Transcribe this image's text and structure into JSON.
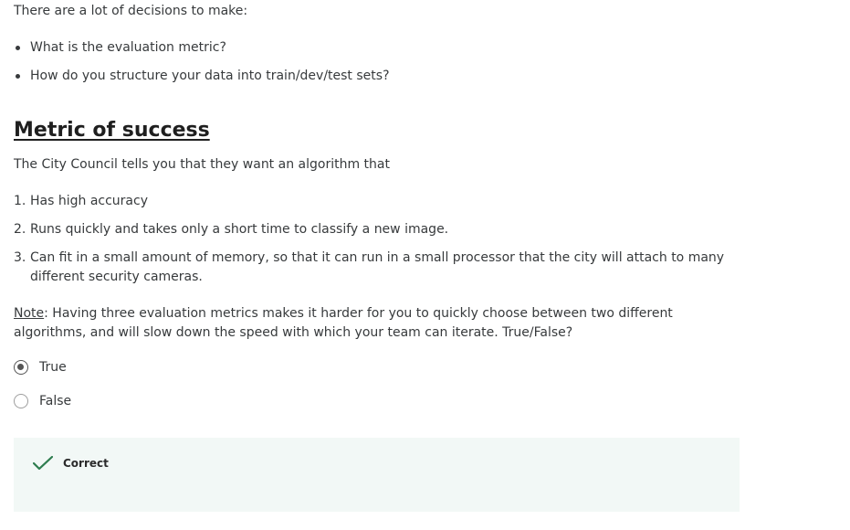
{
  "intro_text": "There are a lot of decisions to make:",
  "bullets": [
    "What is the evaluation metric?",
    "How do you structure your data into train/dev/test sets?"
  ],
  "section_title": "Metric of success",
  "council_text": "The City Council tells you that they want an algorithm that",
  "requirements": [
    {
      "num": "1.",
      "text": "Has high accuracy"
    },
    {
      "num": "2.",
      "text": "Runs quickly and takes only a short time to classify a new image."
    },
    {
      "num": "3.",
      "text": "Can fit in a small amount of memory, so that it can run in a small processor that the city will attach to many different security cameras."
    }
  ],
  "question": {
    "note_label": "Note",
    "text": ": Having three evaluation metrics makes it harder for you to quickly choose between two different algorithms, and will slow down the speed with which your team can iterate. True/False?"
  },
  "options": [
    {
      "label": "True",
      "selected": true
    },
    {
      "label": "False",
      "selected": false
    }
  ],
  "feedback": {
    "label": "Correct",
    "icon": "check-icon",
    "color": "#2e7d4f"
  }
}
